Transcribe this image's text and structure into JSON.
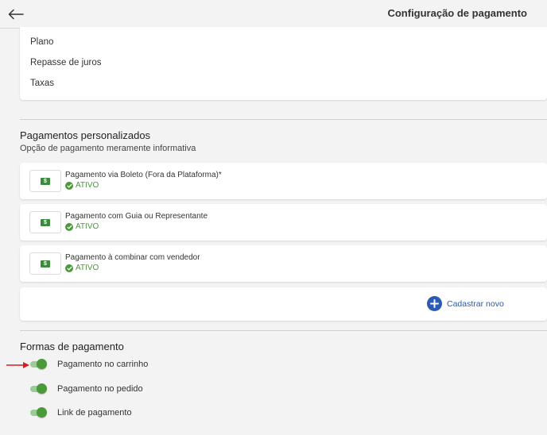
{
  "header": {
    "title": "Configuração de pagamento"
  },
  "info_card": {
    "items": [
      "Plano",
      "Repasse de juros",
      "Taxas"
    ]
  },
  "custom_payments": {
    "title": "Pagamentos personalizados",
    "subtitle": "Opção de pagamento meramente informativa",
    "items": [
      {
        "name": "Pagamento via Boleto (Fora da Plataforma)*",
        "status": "ATIVO"
      },
      {
        "name": "Pagamento com Guia ou Representante",
        "status": "ATIVO"
      },
      {
        "name": "Pagamento à combinar com vendedor",
        "status": "ATIVO"
      }
    ],
    "add_label": "Cadastrar novo"
  },
  "payment_forms": {
    "title": "Formas de pagamento",
    "options": [
      {
        "label": "Pagamento no carrinho",
        "enabled": true
      },
      {
        "label": "Pagamento no pedido",
        "enabled": true
      },
      {
        "label": "Link de pagamento",
        "enabled": true
      }
    ]
  },
  "colors": {
    "accent_green": "#4a9a3a",
    "accent_blue": "#2b5bb5",
    "annotation_red": "#d62020"
  },
  "icons": {
    "back": "arrow-left-icon",
    "money": "money-bill-icon",
    "status": "check-circle-icon",
    "add": "plus-circle-icon"
  }
}
